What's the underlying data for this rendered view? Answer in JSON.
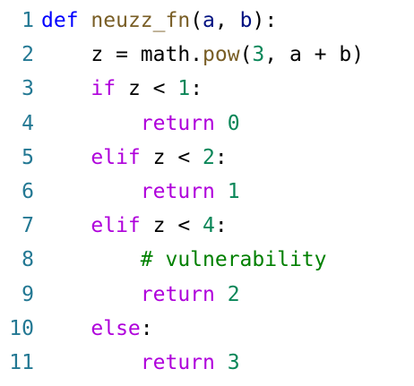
{
  "editor": {
    "colors": {
      "background": "#ffffff",
      "line_number": "#237893",
      "keyword_def": "#0000ff",
      "keyword_control": "#af00db",
      "function_name": "#795e26",
      "number": "#098658",
      "parameter": "#001080",
      "comment": "#008000",
      "text": "#000000"
    },
    "lines": [
      {
        "num": "1",
        "tokens": [
          {
            "t": "def",
            "c": "kw"
          },
          {
            "t": " ",
            "c": "plain"
          },
          {
            "t": "neuzz_fn",
            "c": "fn"
          },
          {
            "t": "(",
            "c": "plain"
          },
          {
            "t": "a",
            "c": "param"
          },
          {
            "t": ", ",
            "c": "plain"
          },
          {
            "t": "b",
            "c": "param"
          },
          {
            "t": "):",
            "c": "plain"
          }
        ]
      },
      {
        "num": "2",
        "tokens": [
          {
            "t": "    z = math.",
            "c": "plain"
          },
          {
            "t": "pow",
            "c": "fn"
          },
          {
            "t": "(",
            "c": "plain"
          },
          {
            "t": "3",
            "c": "num"
          },
          {
            "t": ", a + b)",
            "c": "plain"
          }
        ]
      },
      {
        "num": "3",
        "tokens": [
          {
            "t": "    ",
            "c": "plain"
          },
          {
            "t": "if",
            "c": "ctrl"
          },
          {
            "t": " z < ",
            "c": "plain"
          },
          {
            "t": "1",
            "c": "num"
          },
          {
            "t": ":",
            "c": "plain"
          }
        ]
      },
      {
        "num": "4",
        "tokens": [
          {
            "t": "        ",
            "c": "plain"
          },
          {
            "t": "return",
            "c": "ctrl"
          },
          {
            "t": " ",
            "c": "plain"
          },
          {
            "t": "0",
            "c": "num"
          }
        ]
      },
      {
        "num": "5",
        "tokens": [
          {
            "t": "    ",
            "c": "plain"
          },
          {
            "t": "elif",
            "c": "ctrl"
          },
          {
            "t": " z < ",
            "c": "plain"
          },
          {
            "t": "2",
            "c": "num"
          },
          {
            "t": ":",
            "c": "plain"
          }
        ]
      },
      {
        "num": "6",
        "tokens": [
          {
            "t": "        ",
            "c": "plain"
          },
          {
            "t": "return",
            "c": "ctrl"
          },
          {
            "t": " ",
            "c": "plain"
          },
          {
            "t": "1",
            "c": "num"
          }
        ]
      },
      {
        "num": "7",
        "tokens": [
          {
            "t": "    ",
            "c": "plain"
          },
          {
            "t": "elif",
            "c": "ctrl"
          },
          {
            "t": " z < ",
            "c": "plain"
          },
          {
            "t": "4",
            "c": "num"
          },
          {
            "t": ":",
            "c": "plain"
          }
        ]
      },
      {
        "num": "8",
        "tokens": [
          {
            "t": "        ",
            "c": "plain"
          },
          {
            "t": "# vulnerability",
            "c": "cm"
          }
        ]
      },
      {
        "num": "9",
        "tokens": [
          {
            "t": "        ",
            "c": "plain"
          },
          {
            "t": "return",
            "c": "ctrl"
          },
          {
            "t": " ",
            "c": "plain"
          },
          {
            "t": "2",
            "c": "num"
          }
        ]
      },
      {
        "num": "10",
        "tokens": [
          {
            "t": "    ",
            "c": "plain"
          },
          {
            "t": "else",
            "c": "ctrl"
          },
          {
            "t": ":",
            "c": "plain"
          }
        ]
      },
      {
        "num": "11",
        "tokens": [
          {
            "t": "        ",
            "c": "plain"
          },
          {
            "t": "return",
            "c": "ctrl"
          },
          {
            "t": " ",
            "c": "plain"
          },
          {
            "t": "3",
            "c": "num"
          }
        ]
      }
    ]
  }
}
